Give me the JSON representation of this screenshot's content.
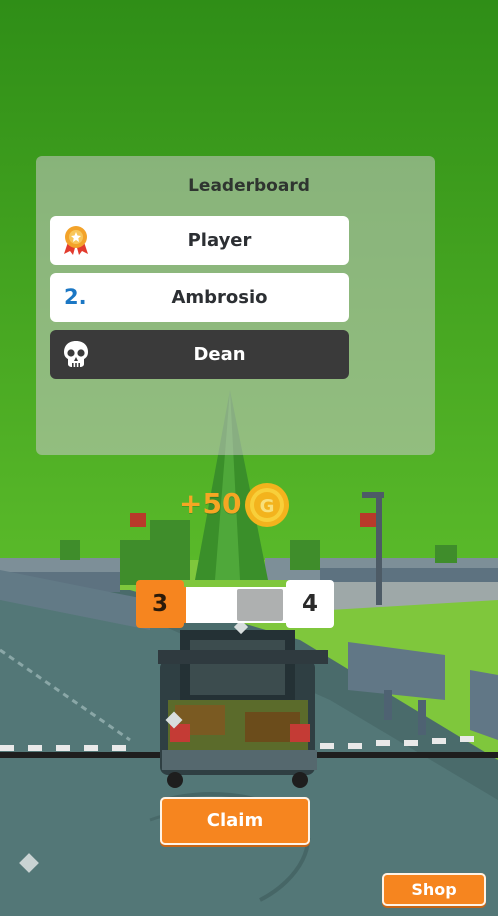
{
  "leaderboard": {
    "title": "Leaderboard",
    "rows": [
      {
        "rank_icon": "medal-icon",
        "name": "Player"
      },
      {
        "rank_label": "2.",
        "name": "Ambrosio"
      },
      {
        "rank_icon": "skull-icon",
        "name": "Dean"
      }
    ]
  },
  "reward": {
    "text": "+50",
    "coin_icon": "gold-coin-icon",
    "coin_letter": "G"
  },
  "level": {
    "current": "3",
    "next": "4",
    "progress": 0.02
  },
  "buttons": {
    "claim": "Claim",
    "shop": "Shop"
  },
  "colors": {
    "accent_orange": "#f6851f",
    "sky_green": "#3c9a1c",
    "rank_blue": "#1b77c4",
    "reward_gold": "#f6a623"
  }
}
